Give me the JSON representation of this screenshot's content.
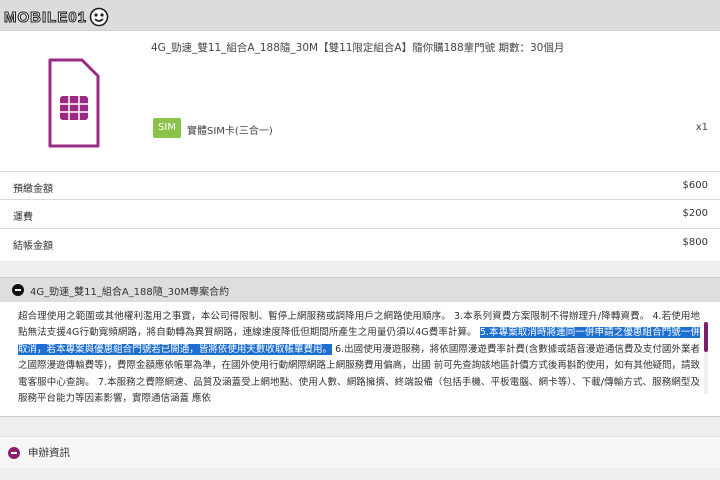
{
  "watermark": {
    "text": "MOBILE01",
    "logo_icon": "smiley-face-icon"
  },
  "order": {
    "product_name": "4G_勁速_雙11_組合A_188隨_30M【雙11限定組合A】隨你購188輩門號 期數：30個月",
    "sim_badge": "SIM",
    "sim_type": "實體SIM卡(三合一)",
    "quantity": "x1",
    "rows": [
      {
        "label": "預繳金額",
        "value": "$600"
      },
      {
        "label": "運費",
        "value": "$200"
      },
      {
        "label": "結帳金額",
        "value": "$800"
      }
    ]
  },
  "contract": {
    "title": "4G_勁速_雙11_組合A_188隨_30M專案合約",
    "text_before": "超合理使用之範圍或其他權利濫用之事實，本公司得限制、暫停上網服務或調降用戶之網路使用順序。 3.本系列資費方案限制不得辦理升/降轉資費。 4.若使用地點無法支援4G行動寬頻網路，將自動轉為異質網路，連線速度降低但期間所產生之用量仍須以4G費率計算。 ",
    "highlight": "5.本專案取消時將連同一併申請之優惠組合門號一併取消，若本專案與優惠組合門號若已開通，皆將依使用天數收取帳單費用。",
    "text_after": " 6.出國使用漫遊服務，將依國際漫遊費率計費(含數據或語音漫遊通信費及支付國外業者之國際漫遊傳輸費等)，費際金額應依帳單為準，在國外使用行動網際網路上網服務費用偏高，出國 前可先查詢該地區計價方式後再斟酌使用，如有其他疑問，請致電客服中心查詢。 7.本服務之費際網速、品質及涵蓋受上網地點、使用人數、網路擁擠、終端設備（包括手機、平板電腦、網卡等）、下載/傳輸方式、服務網型及服務平台能力等因素影響，實際通信涵蓋 應依"
  },
  "apply": {
    "label": "申辦資訊"
  },
  "colors": {
    "accent": "#8a1f72",
    "badge": "#8bc34a",
    "highlight": "#1f6fd1"
  }
}
